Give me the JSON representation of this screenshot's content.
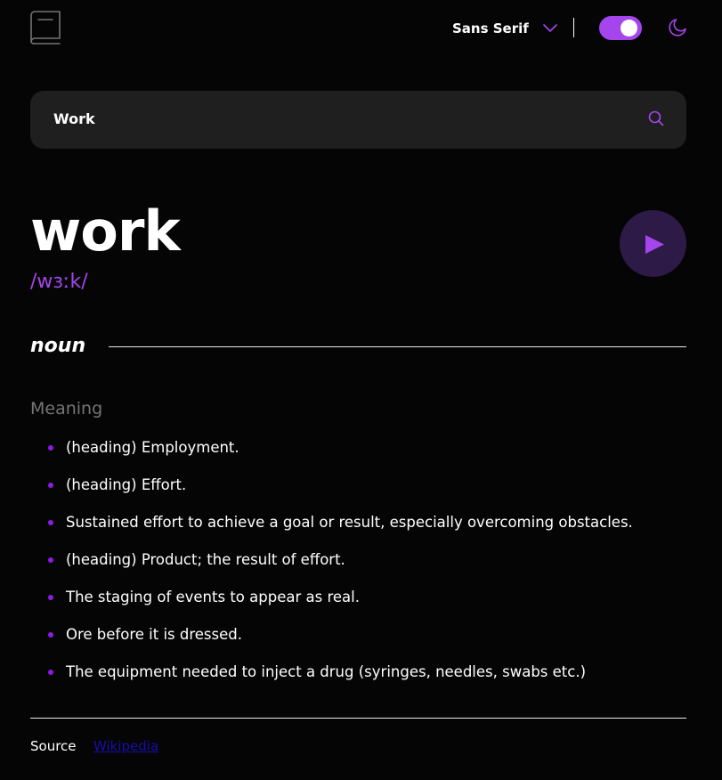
{
  "header": {
    "logo_icon": "book-icon",
    "font_selector": {
      "selected": "Sans Serif",
      "icon": "chevron-down-icon"
    },
    "theme_toggle": {
      "state": "on",
      "icon": "moon-icon"
    }
  },
  "search": {
    "value": "Work",
    "icon": "search-icon"
  },
  "entry": {
    "word": "work",
    "phonetic": "/wɜːk/",
    "play_icon": "play-icon",
    "part_of_speech": "noun",
    "meaning_label": "Meaning",
    "definitions": [
      "(heading) Employment.",
      "(heading) Effort.",
      "Sustained effort to achieve a goal or result, especially overcoming obstacles.",
      "(heading) Product; the result of effort.",
      "The staging of events to appear as real.",
      "Ore before it is dressed.",
      "The equipment needed to inject a drug (syringes, needles, swabs etc.)"
    ]
  },
  "footer": {
    "source_label": "Source",
    "source_link": "Wikipedia"
  },
  "colors": {
    "accent": "#a445ed",
    "bullet": "#8f19e8",
    "background": "#050505",
    "search_bg": "#1f1f1f",
    "play_bg": "#2e1a47",
    "muted_text": "#757575",
    "link": "#1a0dab"
  }
}
